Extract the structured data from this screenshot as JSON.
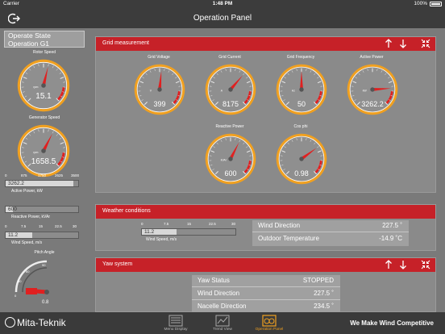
{
  "status_bar": {
    "carrier": "Carrier",
    "time": "1:48 PM",
    "battery": "100%"
  },
  "header": {
    "title": "Operation Panel"
  },
  "left": {
    "state_line1": "Operate State",
    "state_line2": "Operation G1",
    "rotor": {
      "label": "Rotor Speed",
      "value": "15.1",
      "unit": "rpm",
      "fraction": 0.55
    },
    "generator": {
      "label": "Generator Speed",
      "value": "1658.5",
      "unit": "rpm",
      "fraction": 0.6
    },
    "active_power": {
      "ticks": [
        "0",
        "875",
        "1750",
        "2625",
        "3500"
      ],
      "value": "3262.2",
      "label": "Active Power, kW",
      "fraction": 0.93
    },
    "reactive_power": {
      "value": "600",
      "label": "Reactive Power, kVAr",
      "fraction": 0.1
    },
    "wind_speed": {
      "ticks": [
        "0",
        "7.5",
        "15",
        "22.5",
        "30"
      ],
      "value": "11.2",
      "label": "Wind Speed, m/s",
      "fraction": 0.37
    },
    "pitch": {
      "label": "Pitch Angle",
      "value": "0.8",
      "tick_labels": [
        "90",
        "60",
        "30",
        "0"
      ]
    }
  },
  "grid": {
    "title": "Grid measurement",
    "gauges": [
      {
        "label": "Grid Voltage",
        "value": "399",
        "unit": "V",
        "fraction": 0.52
      },
      {
        "label": "Grid Current",
        "value": "8175",
        "unit": "A",
        "fraction": 0.65
      },
      {
        "label": "Grid Frequency",
        "value": "50",
        "unit": "Hz",
        "fraction": 0.5
      },
      {
        "label": "Active Power",
        "value": "3262.2",
        "unit": "kW",
        "fraction": 0.82
      },
      {
        "label": "Reactive Power",
        "value": "600",
        "unit": "kVAr",
        "fraction": 0.6
      },
      {
        "label": "Cos phi",
        "value": "0.98",
        "unit": "",
        "fraction": 0.7
      }
    ]
  },
  "weather": {
    "title": "Weather conditions",
    "ticks": [
      "0",
      "7.5",
      "15",
      "22.5",
      "30"
    ],
    "wind_value": "11.2",
    "wind_label": "Wind Speed, m/s",
    "wind_fraction": 0.37,
    "rows": [
      {
        "key": "Wind Direction",
        "value": "227.5 ˚"
      },
      {
        "key": "Outdoor Temperature",
        "value": "-14.9 ˚C"
      }
    ]
  },
  "yaw": {
    "title": "Yaw system",
    "rows": [
      {
        "key": "Yaw Status",
        "value": "STOPPED"
      },
      {
        "key": "Wind Direction",
        "value": "227.5 ˚"
      },
      {
        "key": "Nacelle Direction",
        "value": "234.5 ˚"
      }
    ]
  },
  "bottom": {
    "brand": "Mita-Teknik",
    "nav": [
      {
        "label": "Menu Display",
        "active": false
      },
      {
        "label": "Trend View",
        "active": false
      },
      {
        "label": "Operation Panel",
        "active": true
      }
    ],
    "slogan": "We Make Wind Competitive"
  },
  "colors": {
    "accent_red": "#c62128",
    "gauge_ring": "#f0a020",
    "needle": "#e02020"
  }
}
